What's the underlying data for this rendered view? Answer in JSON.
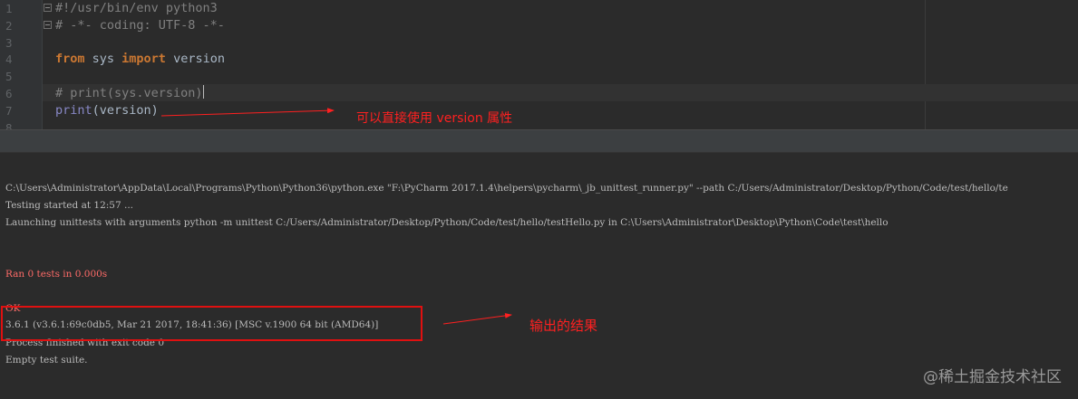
{
  "editor": {
    "line_numbers": [
      "1",
      "2",
      "3",
      "4",
      "5",
      "6",
      "7",
      "8"
    ],
    "lines": [
      {
        "segments": [
          {
            "cls": "cm",
            "text": "#!/usr/bin/env python3"
          }
        ]
      },
      {
        "segments": [
          {
            "cls": "cm",
            "text": "# -*- coding: UTF-8 -*-"
          }
        ]
      },
      {
        "segments": []
      },
      {
        "segments": [
          {
            "cls": "kw",
            "text": "from"
          },
          {
            "cls": "",
            "text": " sys "
          },
          {
            "cls": "kw",
            "text": "import"
          },
          {
            "cls": "",
            "text": " version"
          }
        ]
      },
      {
        "segments": []
      },
      {
        "segments": [
          {
            "cls": "cm",
            "text": "# print(sys.version)"
          },
          {
            "cls": "caret",
            "text": ""
          }
        ]
      },
      {
        "segments": [
          {
            "cls": "fn",
            "text": "print"
          },
          {
            "cls": "",
            "text": "(version)"
          }
        ]
      },
      {
        "segments": []
      }
    ]
  },
  "annotations": {
    "editor_note": "可以直接使用 version 属性",
    "result_note": "输出的结果"
  },
  "console": {
    "lines": [
      {
        "text": "C:\\Users\\Administrator\\AppData\\Local\\Programs\\Python\\Python36\\python.exe \"F:\\PyCharm 2017.1.4\\helpers\\pycharm\\_jb_unittest_runner.py\" --path C:/Users/Administrator/Desktop/Python/Code/test/hello/te",
        "color": "normal"
      },
      {
        "text": "Testing started at 12:57 ...",
        "color": "normal"
      },
      {
        "text": "Launching unittests with arguments python -m unittest C:/Users/Administrator/Desktop/Python/Code/test/hello/testHello.py in C:\\Users\\Administrator\\Desktop\\Python\\Code\\test\\hello",
        "color": "normal"
      },
      {
        "text": "Ran 0 tests in 0.000s",
        "color": "red"
      },
      {
        "text": "OK",
        "color": "red"
      },
      {
        "text": "3.6.1 (v3.6.1:69c0db5, Mar 21 2017, 18:41:36) [MSC v.1900 64 bit (AMD64)]",
        "color": "normal"
      },
      {
        "text": "Process finished with exit code 0",
        "color": "normal"
      },
      {
        "text": "Empty test suite.",
        "color": "normal"
      }
    ]
  },
  "watermark": "@稀土掘金技术社区",
  "colors": {
    "annotation_red": "#ff2020",
    "console_error": "#ff6b68",
    "keyword": "#cc7832",
    "comment": "#808080",
    "builtin": "#8888c6"
  }
}
